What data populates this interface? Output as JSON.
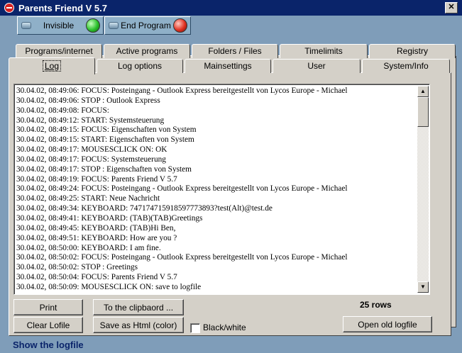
{
  "window": {
    "title": "Parents Friend V 5.7",
    "close_symbol": "✕"
  },
  "top_buttons": {
    "invisible": "Invisible",
    "end_program": "End Program"
  },
  "tabs_back": [
    "Programs/internet",
    "Active programs",
    "Folders / Files",
    "Timelimits",
    "Registry"
  ],
  "tabs_front": [
    "Log",
    "Log options",
    "Mainsettings",
    "User",
    "System/Info"
  ],
  "active_tab": "Log",
  "log_lines": [
    "30.04.02, 08:49:06: FOCUS: Posteingang - Outlook Express bereitgestellt von Lycos Europe - Michael",
    "30.04.02, 08:49:06: STOP : Outlook Express",
    "30.04.02, 08:49:08: FOCUS:",
    "30.04.02, 08:49:12: START: Systemsteuerung",
    "30.04.02, 08:49:15: FOCUS: Eigenschaften von System",
    "30.04.02, 08:49:15: START: Eigenschaften von System",
    "30.04.02, 08:49:17: MOUSESCLICK ON: OK",
    "30.04.02, 08:49:17: FOCUS: Systemsteuerung",
    "30.04.02, 08:49:17: STOP : Eigenschaften von System",
    "30.04.02, 08:49:19: FOCUS: Parents Friend V 5.7",
    "30.04.02, 08:49:24: FOCUS: Posteingang - Outlook Express bereitgestellt von Lycos Europe - Michael",
    "30.04.02, 08:49:25: START: Neue Nachricht",
    "30.04.02, 08:49:34: KEYBOARD:  747174715918597773893?test(Alt)@test.de",
    "30.04.02, 08:49:41: KEYBOARD:  (TAB)(TAB)Greetings",
    "30.04.02, 08:49:45: KEYBOARD:  (TAB)Hi Ben,",
    "30.04.02, 08:49:51: KEYBOARD:  How are you ?",
    "30.04.02, 08:50:00: KEYBOARD:  I am fine.",
    "30.04.02, 08:50:02: FOCUS: Posteingang - Outlook Express bereitgestellt von Lycos Europe - Michael",
    "30.04.02, 08:50:02: STOP : Greetings",
    "30.04.02, 08:50:04: FOCUS: Parents Friend V 5.7",
    "30.04.02, 08:50:09: MOUSESCLICK ON: save to logfile"
  ],
  "buttons": {
    "print": "Print",
    "clear_logfile": "Clear Lofile",
    "to_clipboard": "To the clipbaord ...",
    "save_html": "Save as Html (color)",
    "open_old_logfile": "Open old logfile"
  },
  "rows_count": "25 rows",
  "black_white_label": "Black/white",
  "status_text": "Show the logfile",
  "colors": {
    "title_bar": "#0a246a",
    "background": "#7f9db9",
    "face": "#d4d0c8",
    "status_text": "#0a246a"
  }
}
